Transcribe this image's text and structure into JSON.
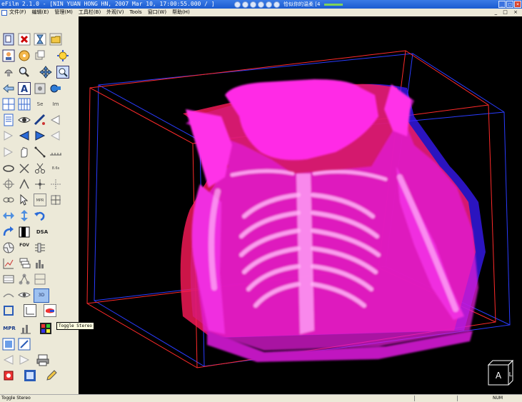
{
  "window": {
    "title": "eFilm 2.1.0 - [NIN YUAN HONG HN, 2007 Mar 10, 17:00:55.000  /  ]",
    "media_song": "恰似你的温柔 [4"
  },
  "menu": {
    "items": [
      "文件(F)",
      "编辑(E)",
      "管理(M)",
      "工具栏(B)",
      "外观(V)",
      "Tools",
      "窗口(W)",
      "帮助(H)"
    ]
  },
  "toolbar": {
    "label_se": "Se",
    "label_im": "Im",
    "label_fov": "FOV",
    "label_dsa": "DSA",
    "label_mpr": "MPR",
    "label_3d": "3D",
    "label_mpr_small": "MPR",
    "label_cine": "8.6s"
  },
  "tooltip": {
    "text": "Toggle Stereo"
  },
  "orientation_cube": {
    "face_a": "A",
    "face_l": "L"
  },
  "statusbar": {
    "text": "Toggle Stereo",
    "num": "NUM"
  },
  "colors": {
    "accent_title": "#1a5bd0",
    "volume_magenta": "#ff2bd6",
    "stereo_red": "#ff1a3a",
    "stereo_blue": "#1c2cff"
  }
}
